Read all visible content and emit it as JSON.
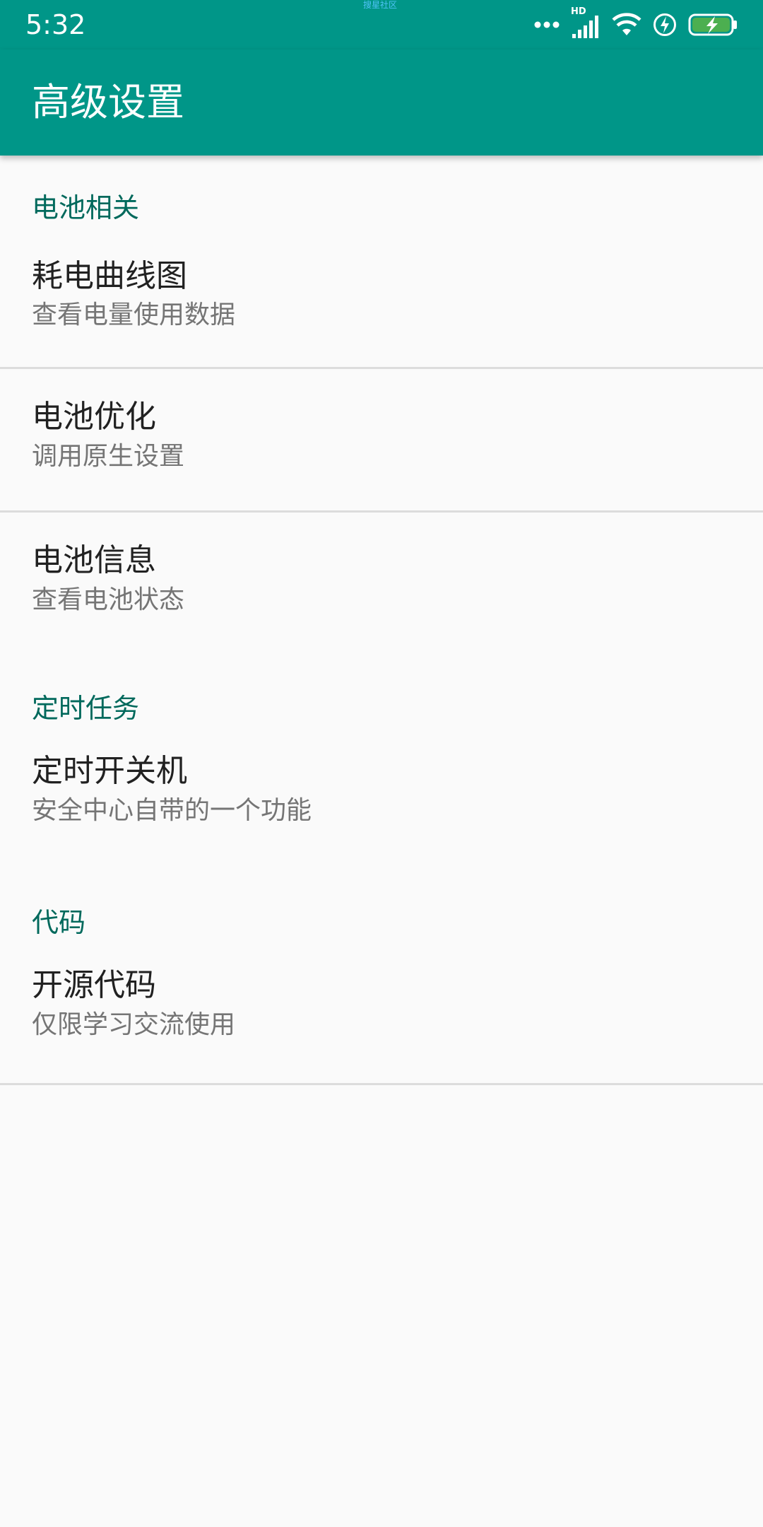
{
  "status_bar": {
    "time": "5:32",
    "center_text": "搜星社区",
    "icons": [
      "more-dots-icon",
      "hd-signal-icon",
      "wifi-icon",
      "flash-icon",
      "battery-charging-icon"
    ],
    "hd_label": "HD",
    "battery_color": "#4caf50"
  },
  "app_bar": {
    "title": "高级设置",
    "color": "#009688"
  },
  "categories": {
    "battery": "电池相关",
    "schedule": "定时任务",
    "code": "代码"
  },
  "items": {
    "power_curve": {
      "title": "耗电曲线图",
      "summary": "查看电量使用数据"
    },
    "battery_opt": {
      "title": "电池优化",
      "summary": "调用原生设置"
    },
    "battery_info": {
      "title": "电池信息",
      "summary": "查看电池状态"
    },
    "scheduled_power": {
      "title": "定时开关机",
      "summary": "安全中心自带的一个功能"
    },
    "open_source": {
      "title": "开源代码",
      "summary": "仅限学习交流使用"
    }
  },
  "colors": {
    "category_text": "#00695c",
    "title_text": "#212121",
    "summary_text": "#757575",
    "background": "#fafafa"
  }
}
